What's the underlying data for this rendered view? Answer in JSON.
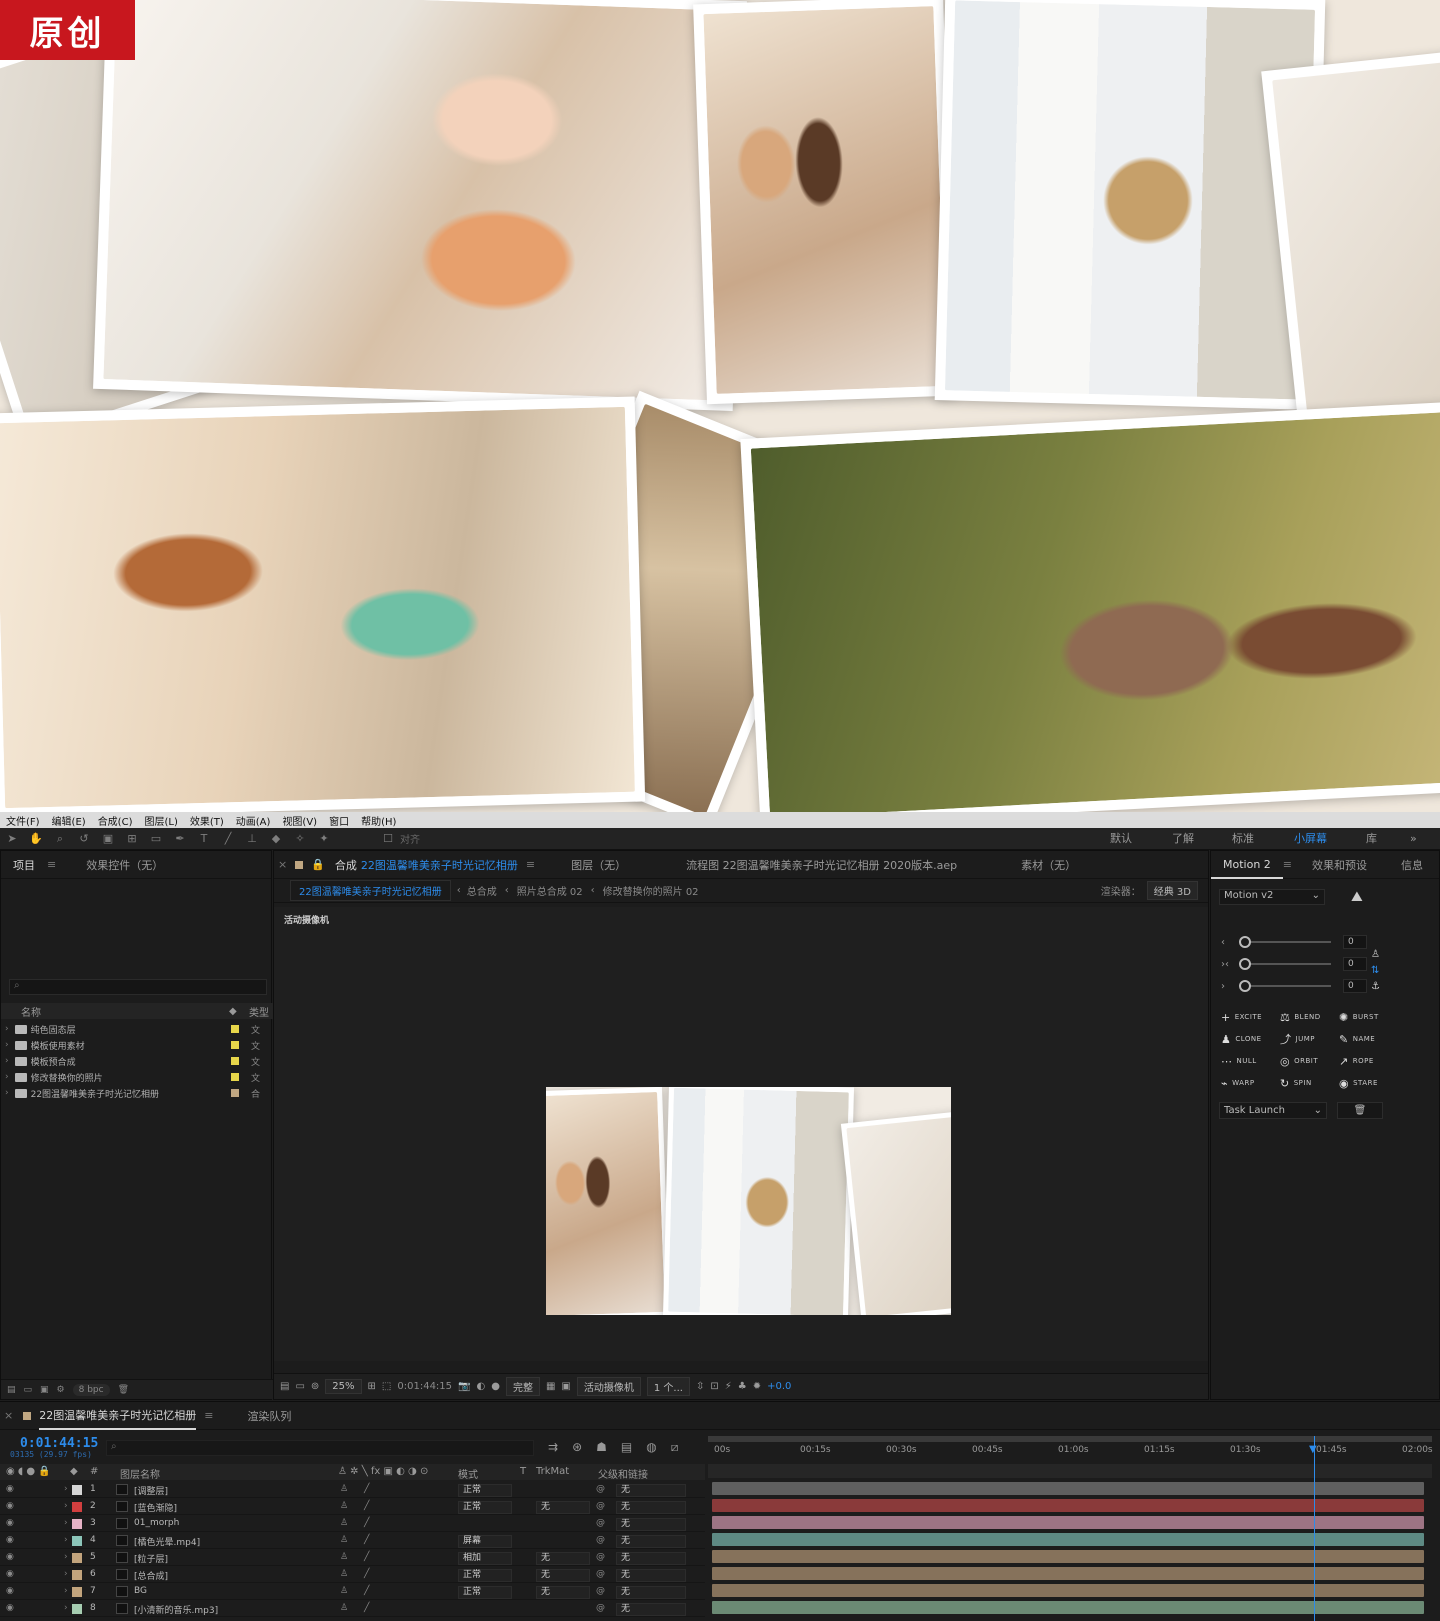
{
  "badge": "原创",
  "menu": [
    "文件(F)",
    "编辑(E)",
    "合成(C)",
    "图层(L)",
    "效果(T)",
    "动画(A)",
    "视图(V)",
    "窗口",
    "帮助(H)"
  ],
  "toolbar": {
    "align_label": "对齐"
  },
  "workspaces": [
    "默认",
    "了解",
    "标准",
    "小屏幕",
    "库"
  ],
  "workspace_active": "小屏幕",
  "project": {
    "tab_project": "项目",
    "tab_effects": "效果控件（无）",
    "col_name": "名称",
    "col_type": "类型",
    "items": [
      {
        "name": "纯色固态层",
        "color": "#e7d64a",
        "type": "文"
      },
      {
        "name": "模板使用素材",
        "color": "#e7d64a",
        "type": "文"
      },
      {
        "name": "模板预合成",
        "color": "#e7d64a",
        "type": "文"
      },
      {
        "name": "修改替换你的照片",
        "color": "#e7d64a",
        "type": "文"
      },
      {
        "name": "22图温馨唯美亲子时光记忆相册",
        "color": "#c0a782",
        "type": "合"
      }
    ],
    "bpc": "8 bpc"
  },
  "comp": {
    "tab_comp_prefix": "合成",
    "comp_name": "22图温馨唯美亲子时光记忆相册",
    "tab_layer": "图层（无）",
    "tab_flow": "流程图 22图温馨唯美亲子时光记忆相册 2020版本.aep",
    "tab_footage": "素材（无）",
    "breadcrumbs": [
      "22图温馨唯美亲子时光记忆相册",
      "总合成",
      "照片总合成 02",
      "修改替换你的照片 02"
    ],
    "renderer_label": "渲染器：",
    "renderer_value": "经典 3D",
    "camera_label": "活动摄像机",
    "zoom": "25%",
    "time": "0:01:44:15",
    "quality": "完整",
    "view": "活动摄像机",
    "views": "1 个...",
    "exposure": "+0.0"
  },
  "effects_panel": {
    "tab_motion": "Motion 2",
    "tab_presets": "效果和预设",
    "tab_info": "信息",
    "version": "Motion v2",
    "sliders": [
      {
        "arrow": "‹",
        "value": "0"
      },
      {
        "arrow": "›‹",
        "value": "0"
      },
      {
        "arrow": "›",
        "value": "0"
      }
    ],
    "buttons": [
      {
        "icon": "+",
        "label": "EXCITE"
      },
      {
        "icon": "⚖",
        "label": "BLEND"
      },
      {
        "icon": "✺",
        "label": "BURST"
      },
      {
        "icon": "♟",
        "label": "CLONE"
      },
      {
        "icon": "⤴",
        "label": "JUMP"
      },
      {
        "icon": "✎",
        "label": "NAME"
      },
      {
        "icon": "⋯",
        "label": "NULL"
      },
      {
        "icon": "◎",
        "label": "ORBIT"
      },
      {
        "icon": "↗",
        "label": "ROPE"
      },
      {
        "icon": "⌁",
        "label": "WARP"
      },
      {
        "icon": "↻",
        "label": "SPIN"
      },
      {
        "icon": "◉",
        "label": "STARE"
      }
    ],
    "task": "Task Launch"
  },
  "timeline": {
    "comp_tab": "22图温馨唯美亲子时光记忆相册",
    "render_tab": "渲染队列",
    "timecode": "0:01:44:15",
    "frames": "03135 (29.97 fps)",
    "col_layer_name": "图层名称",
    "col_mode": "模式",
    "col_t": "T",
    "col_trkmat": "TrkMat",
    "col_parent": "父级和链接",
    "ruler": [
      "00s",
      "00:15s",
      "00:30s",
      "00:45s",
      "01:00s",
      "01:15s",
      "01:30s",
      "01:45s",
      "02:00s"
    ],
    "layers": [
      {
        "num": "1",
        "name": "[调整层]",
        "color": "#d6d6d6",
        "mode": "正常",
        "trk": "",
        "parent": "无",
        "bar": "#5f5f5f"
      },
      {
        "num": "2",
        "name": "[蓝色渐隐]",
        "color": "#d23f3f",
        "mode": "正常",
        "trk": "无",
        "parent": "无",
        "bar": "#8a3a3a"
      },
      {
        "num": "3",
        "name": "01_morph",
        "color": "#e6b3c6",
        "mode": "",
        "trk": "",
        "parent": "无",
        "bar": "#9d7484"
      },
      {
        "num": "4",
        "name": "[橘色光晕.mp4]",
        "color": "#8cc5b9",
        "mode": "屏幕",
        "trk": "",
        "parent": "无",
        "bar": "#5e8a84"
      },
      {
        "num": "5",
        "name": "[粒子层]",
        "color": "#c2a47d",
        "mode": "相加",
        "trk": "无",
        "parent": "无",
        "bar": "#86725b"
      },
      {
        "num": "6",
        "name": "[总合成]",
        "color": "#c2a47d",
        "mode": "正常",
        "trk": "无",
        "parent": "无",
        "bar": "#86725b"
      },
      {
        "num": "7",
        "name": "BG",
        "color": "#c2a47d",
        "mode": "正常",
        "trk": "无",
        "parent": "无",
        "bar": "#86725b"
      },
      {
        "num": "8",
        "name": "[小清新的音乐.mp3]",
        "color": "#a6cdb1",
        "mode": "",
        "trk": "",
        "parent": "无",
        "bar": "#6b8a74"
      }
    ]
  }
}
